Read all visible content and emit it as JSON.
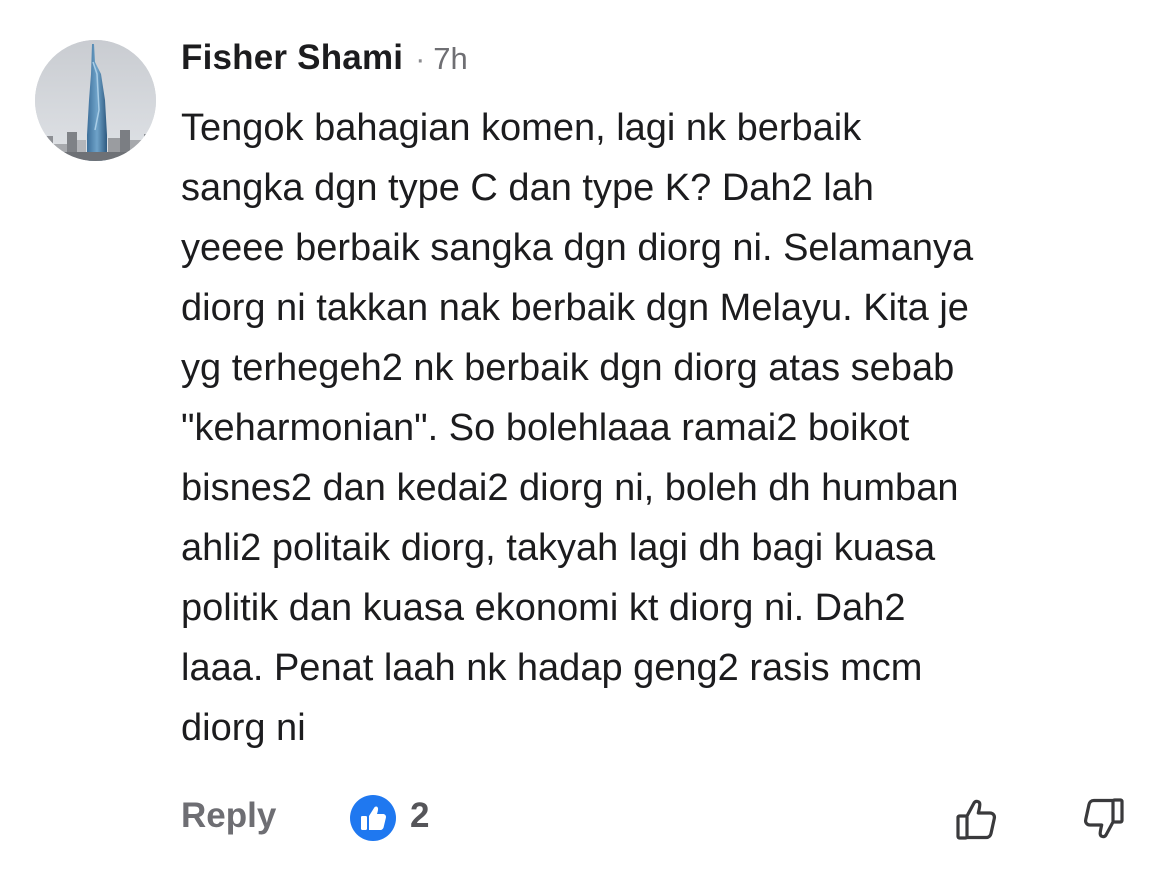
{
  "comment": {
    "author": "Fisher Shami",
    "separator": "·",
    "time": "7h",
    "lines": [
      "Tengok bahagian komen, lagi nk berbaik",
      "sangka dgn type C dan type K? Dah2 lah",
      "yeeee berbaik sangka dgn diorg ni. Selamanya",
      "diorg ni takkan nak berbaik dgn Melayu. Kita je",
      "yg terhegeh2 nk berbaik dgn diorg atas sebab",
      "\"keharmonian\". So bolehlaaa ramai2 boikot",
      "bisnes2 dan kedai2 diorg ni, boleh dh humban",
      "ahli2 politaik diorg, takyah lagi dh bagi kuasa",
      "politik dan kuasa ekonomi kt diorg ni. Dah2",
      "laaa. Penat laah nk hadap geng2 rasis mcm",
      "diorg ni"
    ]
  },
  "actions": {
    "reply_label": "Reply",
    "reaction_icon": "thumbs-up-reaction-icon",
    "reaction_count": "2",
    "upvote_icon": "thumbs-up-outline-icon",
    "downvote_icon": "thumbs-down-outline-icon"
  },
  "colors": {
    "reaction_blue": "#1f78f0",
    "muted_gray": "#6e6e73",
    "text": "#1c1c1e"
  }
}
